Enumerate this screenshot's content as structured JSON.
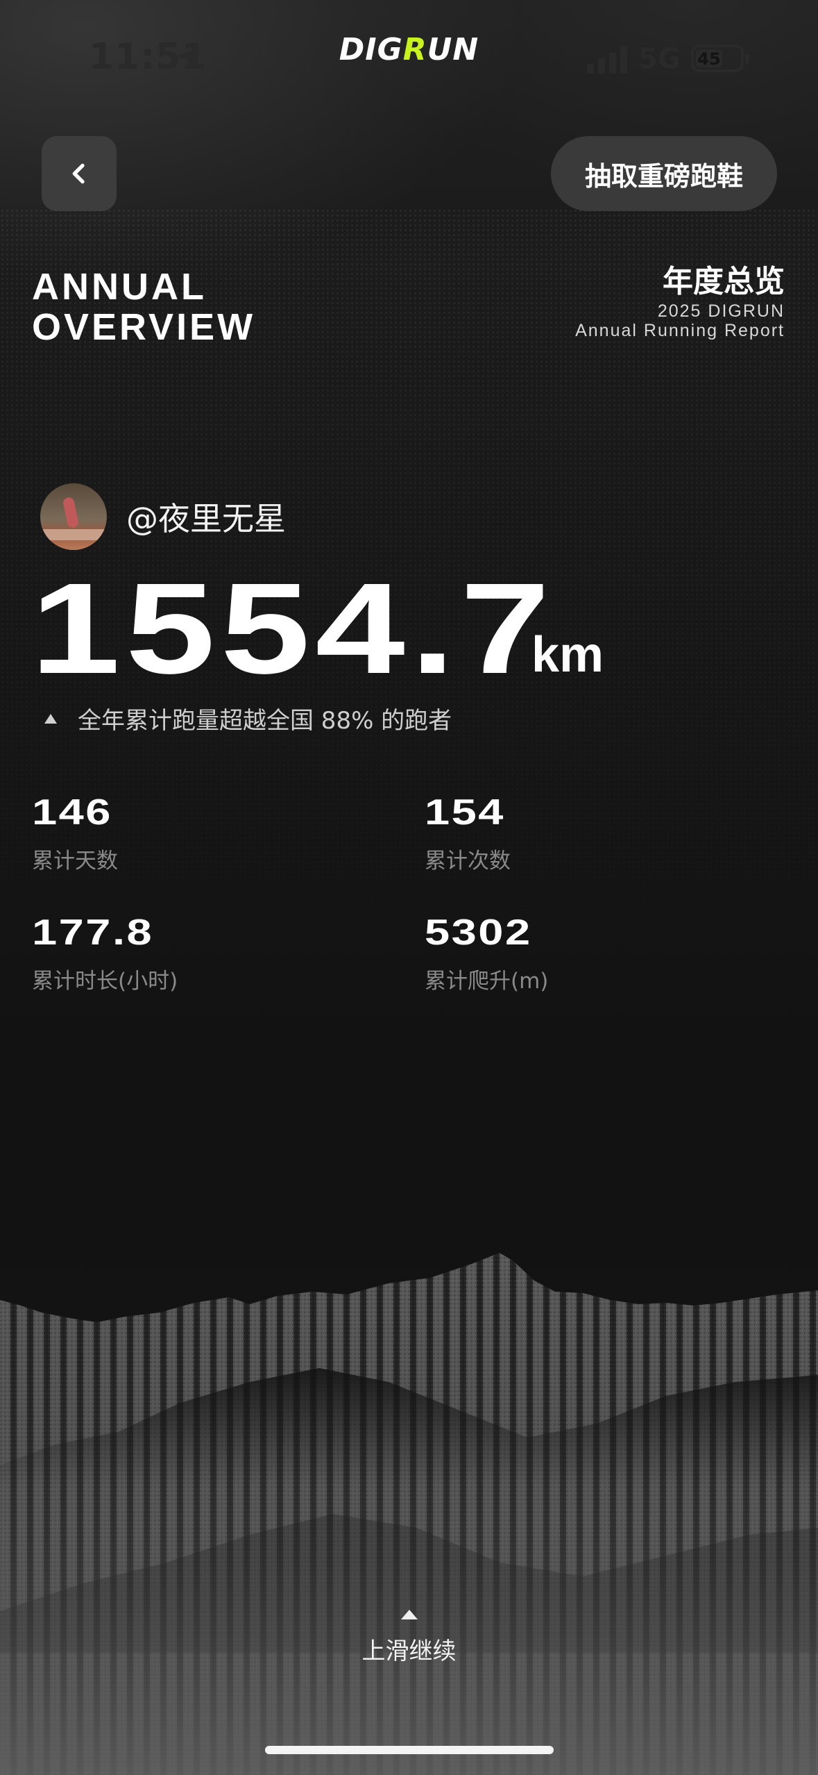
{
  "status_bar": {
    "time": "11:51",
    "network": "5G",
    "battery": "45"
  },
  "app": {
    "logo_part1": "DIG",
    "logo_part2": "R",
    "logo_part3": "UN",
    "accent_color": "#c8f31d"
  },
  "header": {
    "back_icon": "chevron-left-icon",
    "lottery_button": "抽取重磅跑鞋"
  },
  "overview": {
    "title_line1": "ANNUAL",
    "title_line2": "OVERVIEW",
    "cn_title": "年度总览",
    "sub_line1": "2025 DIGRUN",
    "sub_line2": "Annual Running Report"
  },
  "user": {
    "name": "@夜里无星"
  },
  "distance": {
    "value": "1554.7",
    "unit": "km",
    "rank_text": "全年累计跑量超越全国 88% 的跑者"
  },
  "stats": [
    {
      "value": "146",
      "label": "累计天数"
    },
    {
      "value": "154",
      "label": "累计次数"
    },
    {
      "value": "177.8",
      "label": "累计时长(小时)"
    },
    {
      "value": "5302",
      "label": "累计爬升(m)"
    }
  ],
  "footer": {
    "swipe_text": "上滑继续"
  }
}
